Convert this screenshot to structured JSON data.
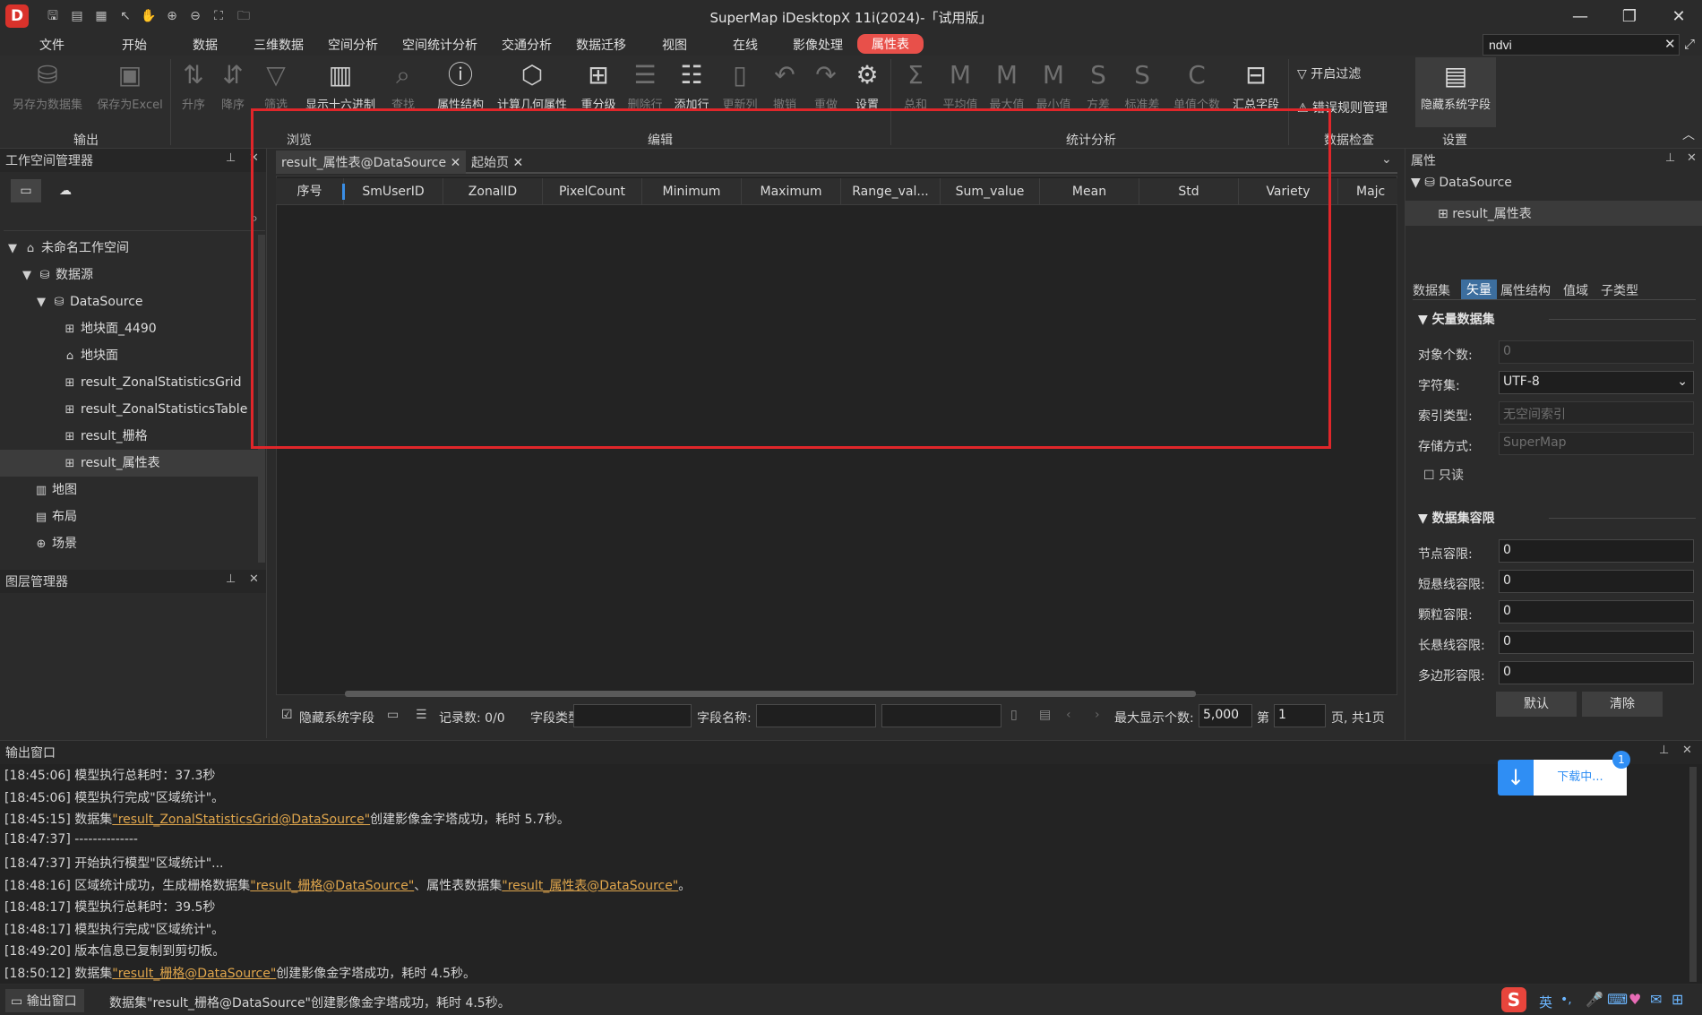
{
  "title": "SuperMap iDesktopX 11i(2024)-「试用版」",
  "menu": [
    "文件",
    "开始",
    "数据",
    "三维数据",
    "空间分析",
    "空间统计分析",
    "交通分析",
    "数据迁移",
    "视图",
    "在线",
    "影像处理",
    "属性表"
  ],
  "search_value": "ndvi",
  "ribbon": {
    "buttons": [
      "另存为数据集",
      "保存为Excel",
      "升序",
      "降序",
      "筛选",
      "显示十六进制",
      "查找",
      "属性结构",
      "计算几何属性",
      "重分级",
      "删除行",
      "添加行",
      "更新列",
      "撤销",
      "重做",
      "设置",
      "总和",
      "平均值",
      "最大值",
      "最小值",
      "方差",
      "标准差",
      "单值个数",
      "汇总字段"
    ],
    "filter_label": "开启过滤",
    "error_rules_label": "错误规则管理",
    "hide_sys_label": "隐藏系统字段",
    "groups": [
      "输出",
      "浏览",
      "编辑",
      "统计分析",
      "数据检查",
      "设置"
    ]
  },
  "workspace_panel": {
    "title": "工作空间管理器",
    "tree": [
      "未命名工作空间",
      "数据源",
      "DataSource",
      "地块面_4490",
      "地块面",
      "result_ZonalStatisticsGrid",
      "result_ZonalStatisticsTable",
      "result_栅格",
      "result_属性表",
      "地图",
      "布局",
      "场景"
    ]
  },
  "layer_panel": {
    "title": "图层管理器"
  },
  "doc_tabs": [
    "result_属性表@DataSource",
    "起始页"
  ],
  "grid": {
    "columns": [
      "序号",
      "SmUserID",
      "ZonalID",
      "PixelCount",
      "Minimum",
      "Maximum",
      "Range_val...",
      "Sum_value",
      "Mean",
      "Std",
      "Variety",
      "Majc"
    ]
  },
  "grid_status": {
    "hide_sys_fields": "隐藏系统字段",
    "records": "记录数: 0/0",
    "field_type_label": "字段类型:",
    "field_name_label": "字段名称:",
    "max_display_label": "最大显示个数:",
    "max_display_value": "5,000",
    "page_label": "第",
    "page_value": "1",
    "page_total": "页, 共1页"
  },
  "props_panel": {
    "title": "属性",
    "tree": [
      "DataSource",
      "result_属性表"
    ],
    "tabs": [
      "数据集",
      "矢量",
      "属性结构",
      "值域",
      "子类型"
    ],
    "section1": "矢量数据集",
    "fields1": [
      {
        "label": "对象个数:",
        "value": "0"
      },
      {
        "label": "字符集:",
        "value": "UTF-8"
      },
      {
        "label": "索引类型:",
        "value": "无空间索引"
      },
      {
        "label": "存储方式:",
        "value": "SuperMap"
      }
    ],
    "readonly_label": "只读",
    "section2": "数据集容限",
    "fields2": [
      {
        "label": "节点容限:",
        "value": "0"
      },
      {
        "label": "短悬线容限:",
        "value": "0"
      },
      {
        "label": "颗粒容限:",
        "value": "0"
      },
      {
        "label": "长悬线容限:",
        "value": "0"
      },
      {
        "label": "多边形容限:",
        "value": "0"
      }
    ],
    "btn_default": "默认",
    "btn_clear": "清除"
  },
  "output": {
    "title": "输出窗口",
    "download_label": "下载中...",
    "download_badge": "1",
    "lines": [
      {
        "pre": "[18:45:06] 模型执行总耗时：37.3秒",
        "link": "",
        "post": "",
        "link2": "",
        "post2": ""
      },
      {
        "pre": "[18:45:06] 模型执行完成\"区域统计\"。",
        "link": "",
        "post": "",
        "link2": "",
        "post2": ""
      },
      {
        "pre": "[18:45:15] 数据集",
        "link": "\"result_ZonalStatisticsGrid@DataSource\"",
        "post": "创建影像金字塔成功，耗时 5.7秒。",
        "link2": "",
        "post2": ""
      },
      {
        "pre": "[18:47:37] --------------",
        "link": "",
        "post": "",
        "link2": "",
        "post2": ""
      },
      {
        "pre": "[18:47:37] 开始执行模型\"区域统计\"...",
        "link": "",
        "post": "",
        "link2": "",
        "post2": ""
      },
      {
        "pre": "[18:48:16] 区域统计成功，生成栅格数据集",
        "link": "\"result_栅格@DataSource\"",
        "post": "、属性表数据集",
        "link2": "\"result_属性表@DataSource\"",
        "post2": "。"
      },
      {
        "pre": "[18:48:17] 模型执行总耗时：39.5秒",
        "link": "",
        "post": "",
        "link2": "",
        "post2": ""
      },
      {
        "pre": "[18:48:17] 模型执行完成\"区域统计\"。",
        "link": "",
        "post": "",
        "link2": "",
        "post2": ""
      },
      {
        "pre": "[18:49:20] 版本信息已复制到剪切板。",
        "link": "",
        "post": "",
        "link2": "",
        "post2": ""
      },
      {
        "pre": "[18:50:12] 数据集",
        "link": "\"result_栅格@DataSource\"",
        "post": "创建影像金字塔成功，耗时 4.5秒。",
        "link2": "",
        "post2": ""
      }
    ]
  },
  "statusbar": {
    "tab": "输出窗口",
    "message": "数据集\"result_栅格@DataSource\"创建影像金字塔成功，耗时 4.5秒。",
    "tray": [
      "英",
      "•,"
    ]
  },
  "colors": {
    "accent": "#e8504a",
    "highlight_box": "#e0262a",
    "link": "#e0a64c"
  }
}
